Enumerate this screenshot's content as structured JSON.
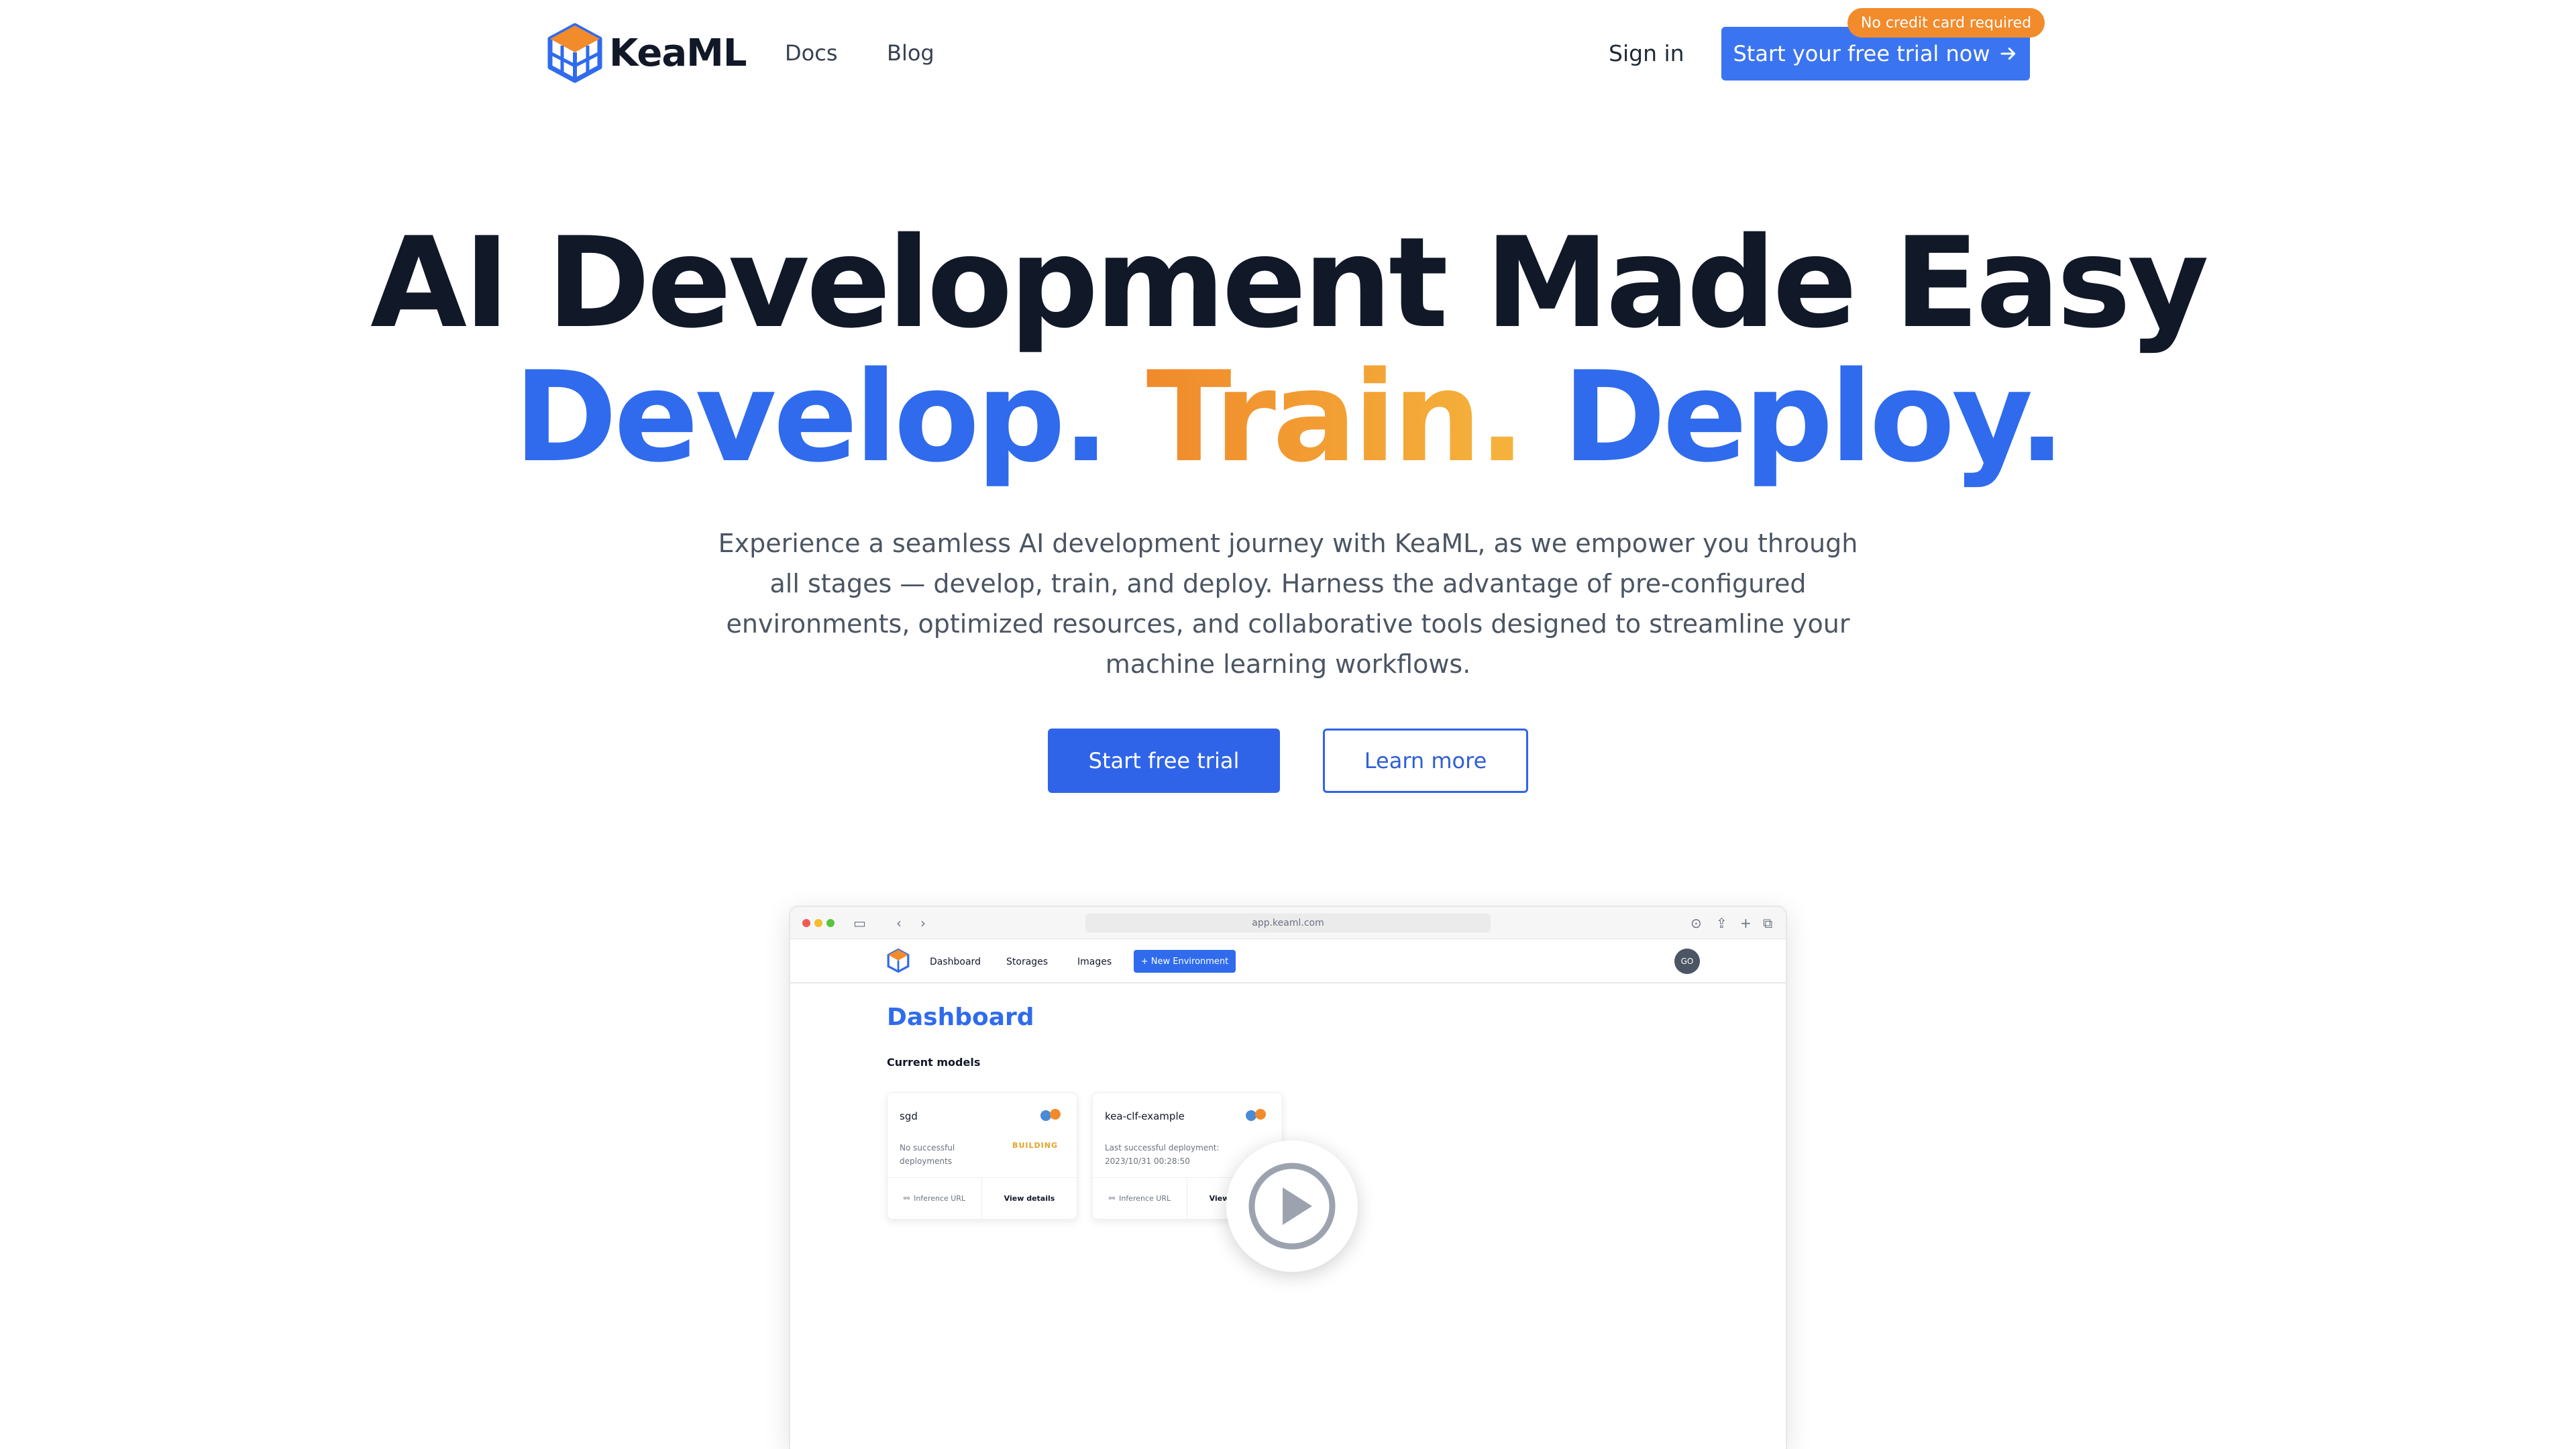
{
  "nav": {
    "brand": "KeaML",
    "links": [
      {
        "label": "Docs"
      },
      {
        "label": "Blog"
      }
    ],
    "sign_in": "Sign in",
    "trial_button": "Start your free trial now",
    "trial_badge": "No credit card required"
  },
  "hero": {
    "title": "AI Development Made Easy",
    "tagline": {
      "develop": "Develop.",
      "train": "Train.",
      "deploy": "Deploy."
    },
    "description": "Experience a seamless AI development journey with KeaML, as we empower you through all stages — develop, train, and deploy. Harness the advantage of pre-configured environments, optimized resources, and collaborative tools designed to streamline your machine learning workflows.",
    "primary_cta": "Start free trial",
    "secondary_cta": "Learn more"
  },
  "preview": {
    "url": "app.keaml.com",
    "nav_links": [
      "Dashboard",
      "Storages",
      "Images"
    ],
    "new_env": "+ New Environment",
    "avatar": "GO",
    "title": "Dashboard",
    "subtitle": "Current models",
    "cards": [
      {
        "name": "sgd",
        "status": "No successful deployments",
        "badge": "BUILDING",
        "footer_left": "Inference URL",
        "footer_right": "View details"
      },
      {
        "name": "kea-clf-example",
        "status": "Last successful deployment: 2023/10/31 00:28:50",
        "badge": "",
        "footer_left": "Inference URL",
        "footer_right": "View details"
      }
    ]
  },
  "colors": {
    "primary": "#3064e8",
    "accent_orange": "#f28b2c",
    "text_dark": "#111827"
  },
  "icons": [
    "kea-cube-logo-icon",
    "arrow-right-icon",
    "play-icon",
    "link-icon"
  ]
}
